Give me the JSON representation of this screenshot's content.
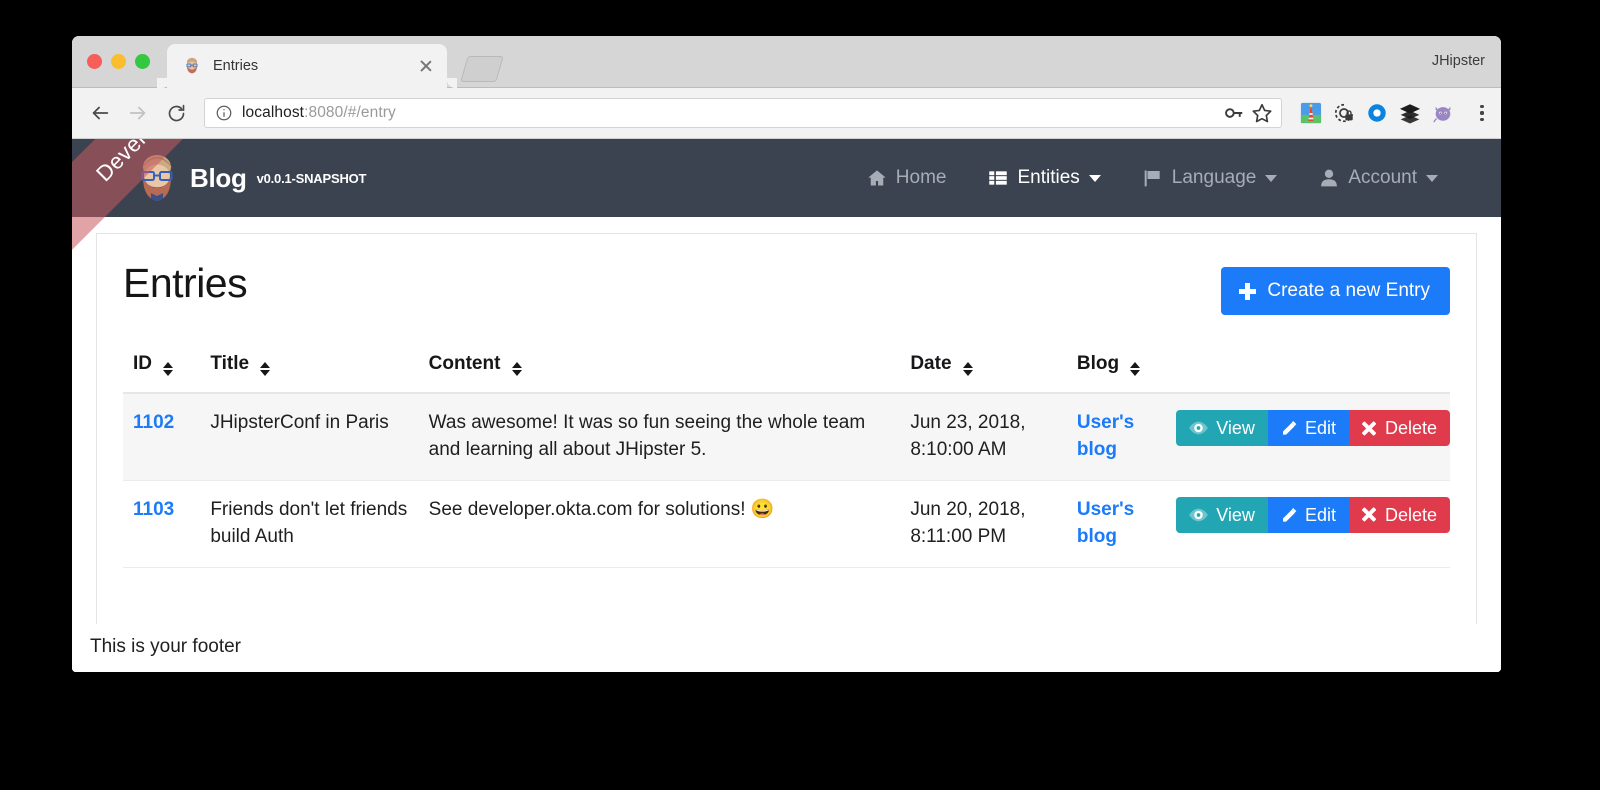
{
  "browser": {
    "tab": {
      "title": "Entries",
      "favicon_icon": "jhipster-avatar-favicon",
      "close_icon": "close-icon"
    },
    "new_tab_icon": "new-tab-button",
    "profile_name": "JHipster",
    "back_icon": "back-arrow-icon",
    "forward_icon": "forward-arrow-icon",
    "reload_icon": "reload-icon",
    "url": {
      "info_icon": "page-info-icon",
      "host": "localhost",
      "rest": ":8080/#/entry",
      "full": "localhost:8080/#/entry"
    },
    "omnibox_icons": [
      "password-key-icon",
      "bookmark-star-icon"
    ],
    "extensions": [
      "lighthouse-icon",
      "privacy-badger-icon",
      "okta-icon",
      "layers-icon",
      "octocat-icon"
    ],
    "menu_icon": "kebab-menu-icon"
  },
  "ribbon": {
    "label": "Development",
    "color": "#c75a5e"
  },
  "navbar": {
    "logo_icon": "jhipster-logo-icon",
    "brand": "Blog",
    "version": "v0.0.1-SNAPSHOT",
    "items": [
      {
        "label": "Home",
        "icon": "home-icon",
        "active": false,
        "caret": false
      },
      {
        "label": "Entities",
        "icon": "th-list-icon",
        "active": true,
        "caret": true
      },
      {
        "label": "Language",
        "icon": "flag-icon",
        "active": false,
        "caret": true
      },
      {
        "label": "Account",
        "icon": "user-icon",
        "active": false,
        "caret": true
      }
    ],
    "background": "#3b4350"
  },
  "page": {
    "title": "Entries",
    "create_button": {
      "label": "Create a new Entry",
      "icon": "plus-icon",
      "color": "#1b7bf8"
    }
  },
  "table": {
    "columns": [
      {
        "label": "ID",
        "sort_icon": "sort-icon"
      },
      {
        "label": "Title",
        "sort_icon": "sort-icon"
      },
      {
        "label": "Content",
        "sort_icon": "sort-icon"
      },
      {
        "label": "Date",
        "sort_icon": "sort-icon"
      },
      {
        "label": "Blog",
        "sort_icon": "sort-icon"
      }
    ],
    "rows": [
      {
        "id": "1102",
        "title": "JHipsterConf in Paris",
        "content": "Was awesome! It was so fun seeing the whole team and learning all about JHipster 5.",
        "date": "Jun 23, 2018, 8:10:00 AM",
        "blog": "User's blog"
      },
      {
        "id": "1103",
        "title": "Friends don't let friends build Auth",
        "content": "See developer.okta.com for solutions! 😀",
        "date": "Jun 20, 2018, 8:11:00 PM",
        "blog": "User's blog"
      }
    ],
    "actions": {
      "view": {
        "label": "View",
        "icon": "eye-icon",
        "color": "#22a6b3"
      },
      "edit": {
        "label": "Edit",
        "icon": "pencil-icon",
        "color": "#1b7bf8"
      },
      "delete": {
        "label": "Delete",
        "icon": "times-icon",
        "color": "#e03b4d"
      }
    }
  },
  "footer": {
    "text": "This is your footer"
  }
}
